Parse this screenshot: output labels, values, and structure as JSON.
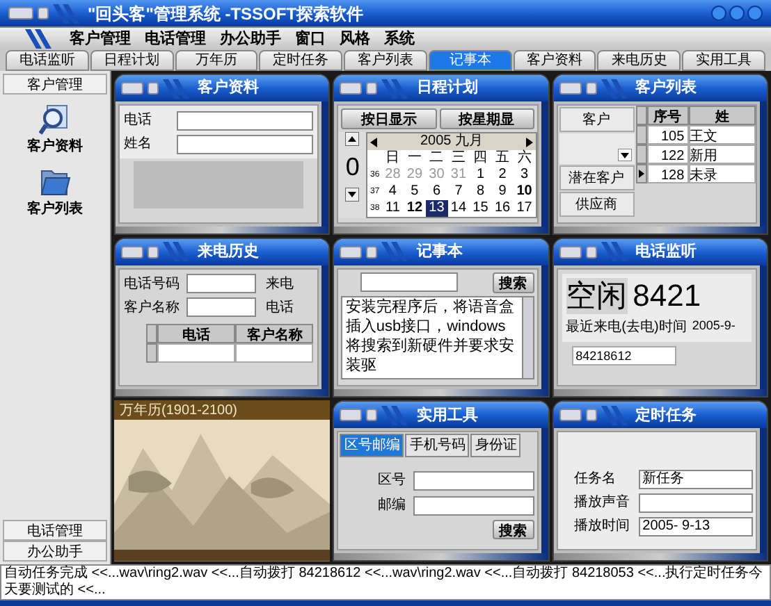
{
  "window": {
    "title": "\"回头客\"管理系统 -TSSOFT探索软件"
  },
  "menu": [
    "客户管理",
    "电话管理",
    "办公助手",
    "窗口",
    "风格",
    "系统"
  ],
  "tabs": [
    {
      "label": "电话监听",
      "selected": false
    },
    {
      "label": "日程计划",
      "selected": false
    },
    {
      "label": "万年历",
      "selected": false
    },
    {
      "label": "定时任务",
      "selected": false
    },
    {
      "label": "客户列表",
      "selected": false
    },
    {
      "label": "记事本",
      "selected": true
    },
    {
      "label": "客户资料",
      "selected": false
    },
    {
      "label": "来电历史",
      "selected": false
    },
    {
      "label": "实用工具",
      "selected": false
    }
  ],
  "sidebar": {
    "header": "客户管理",
    "items": [
      {
        "label": "客户资料",
        "kind": "search"
      },
      {
        "label": "客户列表",
        "kind": "folder"
      }
    ],
    "footer": [
      "电话管理",
      "办公助手"
    ]
  },
  "customer_info": {
    "title": "客户资料",
    "fields": [
      {
        "label": "电话"
      },
      {
        "label": "姓名"
      }
    ]
  },
  "schedule": {
    "title": "日程计划",
    "buttons": [
      "按日显示",
      "按星期显"
    ],
    "time_fragment": "0",
    "calendar": {
      "header": "2005 九月",
      "weekdays": [
        "日",
        "一",
        "二",
        "三",
        "四",
        "五",
        "六"
      ],
      "weeks": [
        {
          "num": "36",
          "days": [
            {
              "d": "28",
              "other": true,
              "bold": false,
              "selected": false
            },
            {
              "d": "29",
              "other": true,
              "bold": false,
              "selected": false
            },
            {
              "d": "30",
              "other": true,
              "bold": false,
              "selected": false
            },
            {
              "d": "31",
              "other": true,
              "bold": false,
              "selected": false
            },
            {
              "d": "1",
              "other": false,
              "bold": false,
              "selected": false
            },
            {
              "d": "2",
              "other": false,
              "bold": false,
              "selected": false
            },
            {
              "d": "3",
              "other": false,
              "bold": false,
              "selected": false
            }
          ]
        },
        {
          "num": "37",
          "days": [
            {
              "d": "4",
              "other": false,
              "bold": false,
              "selected": false
            },
            {
              "d": "5",
              "other": false,
              "bold": false,
              "selected": false
            },
            {
              "d": "6",
              "other": false,
              "bold": false,
              "selected": false
            },
            {
              "d": "7",
              "other": false,
              "bold": false,
              "selected": false
            },
            {
              "d": "8",
              "other": false,
              "bold": false,
              "selected": false
            },
            {
              "d": "9",
              "other": false,
              "bold": false,
              "selected": false
            },
            {
              "d": "10",
              "other": false,
              "bold": true,
              "selected": false
            }
          ]
        },
        {
          "num": "38",
          "days": [
            {
              "d": "11",
              "other": false,
              "bold": false,
              "selected": false
            },
            {
              "d": "12",
              "other": false,
              "bold": true,
              "selected": false
            },
            {
              "d": "13",
              "other": false,
              "bold": false,
              "selected": true
            },
            {
              "d": "14",
              "other": false,
              "bold": false,
              "selected": false
            },
            {
              "d": "15",
              "other": false,
              "bold": false,
              "selected": false
            },
            {
              "d": "16",
              "other": false,
              "bold": false,
              "selected": false
            },
            {
              "d": "17",
              "other": false,
              "bold": false,
              "selected": false
            }
          ]
        }
      ]
    }
  },
  "customer_list": {
    "title": "客户列表",
    "categories": [
      {
        "label": "客户",
        "selected": false
      },
      {
        "label": "潜在客户",
        "selected": false
      },
      {
        "label": "供应商",
        "selected": false
      }
    ],
    "columns": [
      "序号",
      "姓"
    ],
    "rows": [
      {
        "num": "105",
        "name": "王文",
        "selected": false
      },
      {
        "num": "122",
        "name": "新用",
        "selected": false
      },
      {
        "num": "128",
        "name": "未录",
        "selected": true
      }
    ]
  },
  "call_history": {
    "title": "来电历史",
    "fields": [
      {
        "label": "电话号码",
        "side": "来电"
      },
      {
        "label": "客户名称",
        "side": "电话"
      }
    ],
    "columns": [
      "电话",
      "客户名称"
    ]
  },
  "notepad": {
    "title": "记事本",
    "search_button": "搜索",
    "text": "安装完程序后，将语音盒插入usb接口，windows将搜索到新硬件并要求安装驱"
  },
  "phone_monitor": {
    "title": "电话监听",
    "status": "空闲",
    "number": "8421",
    "recent_label": "最近来电(去电)时间",
    "recent_time": "2005-9-",
    "last_number": "84218612"
  },
  "almanac": {
    "header": "万年历(1901-2100)",
    "kind": "picture"
  },
  "tools": {
    "title": "实用工具",
    "tabs": [
      {
        "label": "区号邮编",
        "selected": true
      },
      {
        "label": "手机号码",
        "selected": false
      },
      {
        "label": "身份证",
        "selected": false
      }
    ],
    "fields": [
      {
        "label": "区号"
      },
      {
        "label": "邮编"
      }
    ],
    "button": "搜索"
  },
  "timed_task": {
    "title": "定时任务",
    "fields": [
      {
        "label": "任务名",
        "value": "新任务"
      },
      {
        "label": "播放声音"
      },
      {
        "label": "播放时间",
        "value": "2005- 9-13"
      }
    ]
  },
  "status_bar": "自动任务完成 <<...wav\\ring2.wav <<...自动拨打 84218612 <<...wav\\ring2.wav <<...自动拨打 84218053 <<...执行定时任务今天要测试的 <<..."
}
